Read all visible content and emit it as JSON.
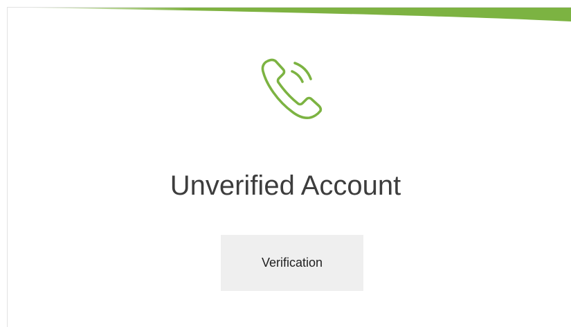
{
  "colors": {
    "accent": "#7cb342",
    "accent_dark": "#5f9a2e",
    "title_text": "#3d3d3d",
    "button_bg": "#efefef"
  },
  "header": {
    "icon": "phone-icon"
  },
  "main": {
    "title": "Unverified Account",
    "button_label": "Verification"
  }
}
